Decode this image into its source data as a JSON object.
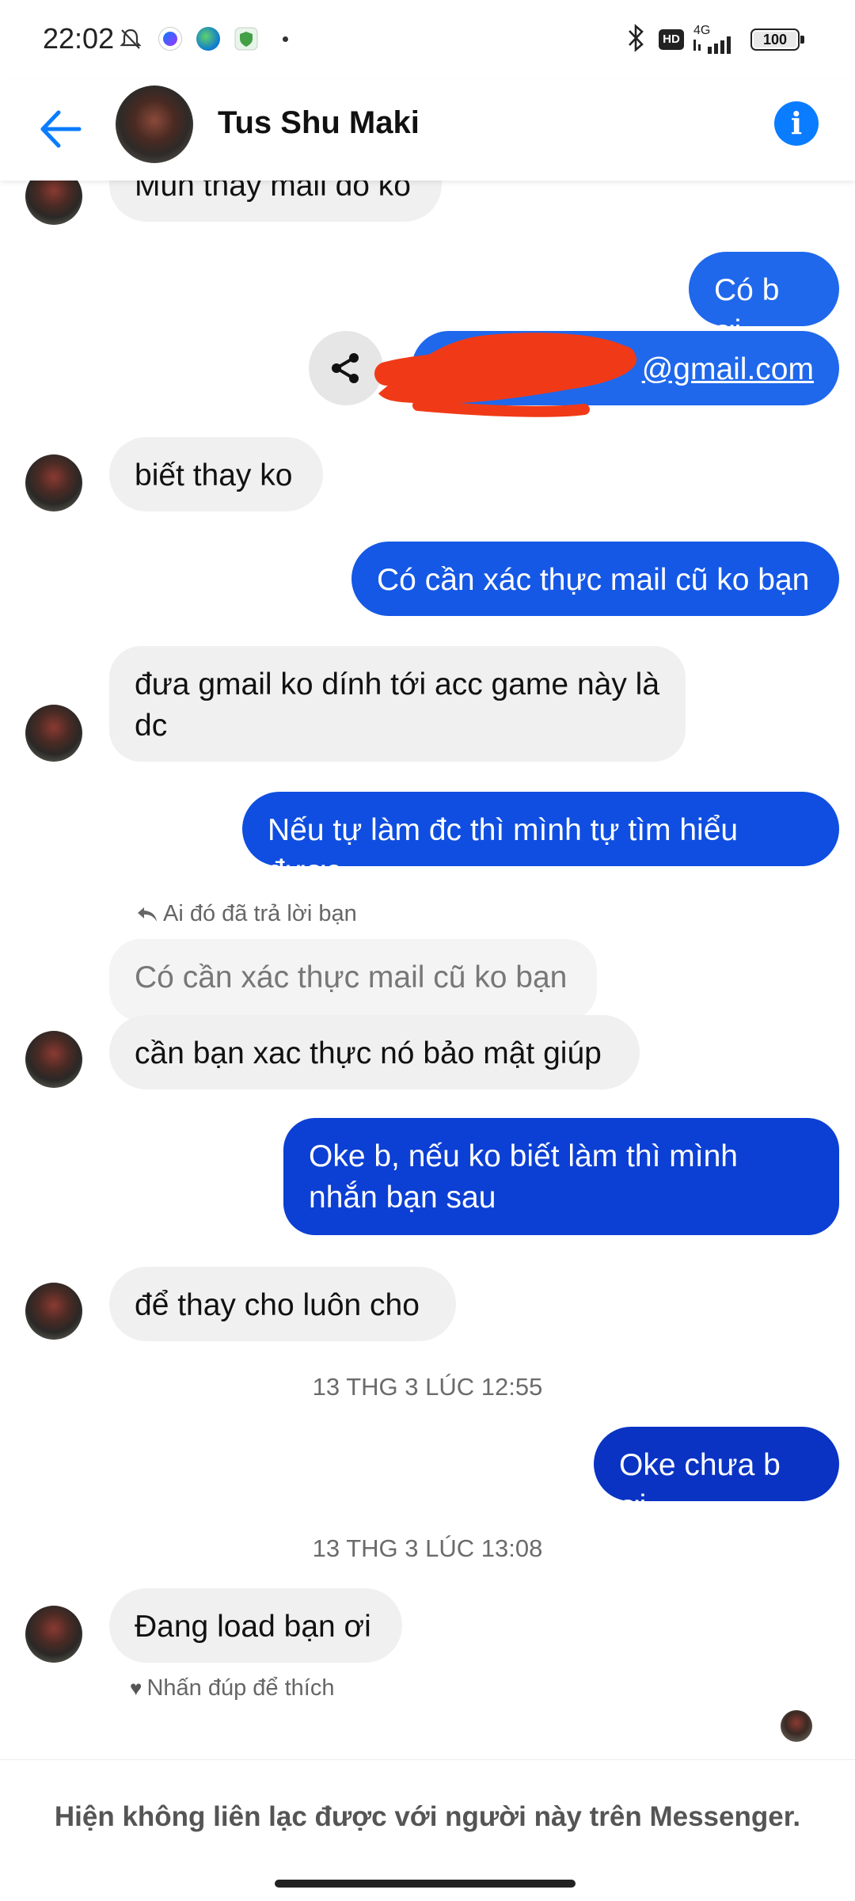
{
  "status_bar": {
    "time": "22:02",
    "network": "4G",
    "battery": "100",
    "hd_badge": "HD",
    "icons": [
      "bell-muted-icon",
      "messenger-icon",
      "edge-icon",
      "shield-icon",
      "dot-icon",
      "bluetooth-icon",
      "signal-icon",
      "battery-icon"
    ]
  },
  "header": {
    "contact_name": "Tus Shu Maki",
    "back_icon": "arrow-left-icon",
    "info_icon": "info-icon",
    "info_glyph": "i"
  },
  "messages": [
    {
      "from": "them",
      "text": "Mun thay mail đó ko"
    },
    {
      "from": "me",
      "text": "Có b ơi"
    },
    {
      "from": "me",
      "text": "@gmail.com",
      "redacted_prefix": true,
      "share_icon": "share-icon"
    },
    {
      "from": "them",
      "text": "biết thay ko"
    },
    {
      "from": "me",
      "text": "Có cần xác thực mail cũ ko bạn"
    },
    {
      "from": "them",
      "text": "đưa gmail ko dính tới acc game này là dc"
    },
    {
      "from": "me",
      "text": "Nếu tự làm đc thì mình tự tìm hiểu được"
    },
    {
      "from": "them",
      "reply_label": "Ai đó đã trả lời bạn",
      "quoted": "Có cần xác thực mail cũ ko bạn",
      "text": "cần bạn xac thực nó bảo mật giúp"
    },
    {
      "from": "me",
      "text": "Oke b, nếu ko biết làm thì mình nhắn bạn sau"
    },
    {
      "from": "them",
      "text": "để thay cho luôn cho"
    },
    {
      "timestamp": "13 THG 3 LÚC 12:55"
    },
    {
      "from": "me",
      "text": "Oke chưa b ơi"
    },
    {
      "timestamp": "13 THG 3 LÚC 13:08"
    },
    {
      "from": "them",
      "text": "Đang load bạn ơi",
      "hint": "Nhấn đúp để thích"
    }
  ],
  "footer": {
    "text": "Hiện không liên lạc được với người này trên Messenger."
  },
  "colors": {
    "accent": "#0a7cff",
    "incoming_bubble": "#f0f0f0",
    "outgoing_bubble_top": "#1f68ec",
    "outgoing_bubble_bottom": "#0a33c4",
    "redaction": "#f03a17"
  }
}
